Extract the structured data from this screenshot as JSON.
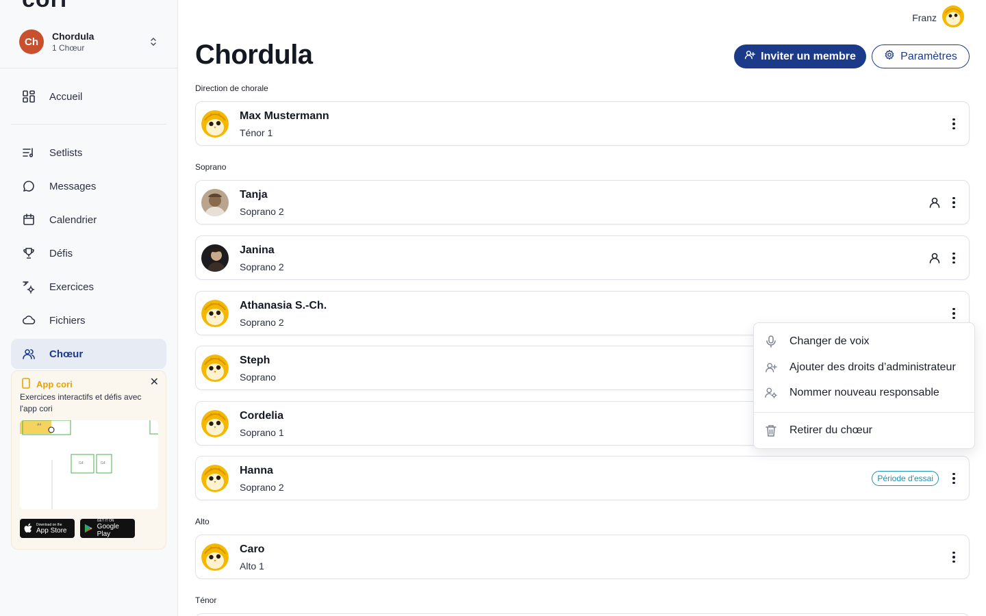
{
  "app": {
    "logo": "cori"
  },
  "user": {
    "name": "Franz"
  },
  "sidebar": {
    "choir": {
      "initials": "Ch",
      "name": "Chordula",
      "count": "1 Chœur"
    },
    "nav_top": [
      {
        "label": "Accueil",
        "icon": "grid-icon"
      }
    ],
    "nav": [
      {
        "label": "Setlists",
        "icon": "setlist-icon"
      },
      {
        "label": "Messages",
        "icon": "chat-bubble-icon"
      },
      {
        "label": "Calendrier",
        "icon": "calendar-icon"
      },
      {
        "label": "Défis",
        "icon": "trophy-icon"
      },
      {
        "label": "Exercices",
        "icon": "exercise-icon"
      },
      {
        "label": "Fichiers",
        "icon": "cloud-icon"
      },
      {
        "label": "Chœur",
        "icon": "users-icon",
        "active": true
      }
    ],
    "promo": {
      "title": "App cori",
      "text": "Exercices interactifs et défis avec l'app cori",
      "appstore_small": "Download on the",
      "appstore_big": "App Store",
      "googleplay_small": "GET IT ON",
      "googleplay_big": "Google Play",
      "image_notes": [
        "A4",
        "G4",
        "G4"
      ]
    }
  },
  "page": {
    "title": "Chordula",
    "invite_label": "Inviter un membre",
    "settings_label": "Paramètres"
  },
  "sections": [
    {
      "label": "Direction de chorale"
    },
    {
      "label": "Soprano"
    },
    {
      "label": "Alto"
    },
    {
      "label": "Ténor"
    }
  ],
  "members": [
    {
      "name": "Max Mustermann",
      "voice": "Ténor 1",
      "avatar": "mascot"
    },
    {
      "name": "Tanja",
      "voice": "Soprano 2",
      "avatar": "photo-light",
      "has_person_icon": true
    },
    {
      "name": "Janina",
      "voice": "Soprano 2",
      "avatar": "photo-dark",
      "has_person_icon": true
    },
    {
      "name": "Athanasia S.-Ch.",
      "voice": "Soprano 2",
      "avatar": "mascot"
    },
    {
      "name": "Steph",
      "voice": "Soprano",
      "avatar": "mascot"
    },
    {
      "name": "Cordelia",
      "voice": "Soprano 1",
      "avatar": "mascot"
    },
    {
      "name": "Hanna",
      "voice": "Soprano 2",
      "avatar": "mascot",
      "badge": "Période d'essai"
    },
    {
      "name": "Caro",
      "voice": "Alto 1",
      "avatar": "mascot"
    }
  ],
  "menu": {
    "items": [
      {
        "label": "Changer de voix",
        "icon": "microphone-icon"
      },
      {
        "label": "Ajouter des droits d’administrateur",
        "icon": "user-plus-icon"
      },
      {
        "label": "Nommer nouveau responsable",
        "icon": "user-cog-icon"
      },
      {
        "label": "Retirer du chœur",
        "icon": "trash-icon"
      }
    ]
  },
  "colors": {
    "primary": "#1b3a8a",
    "choir_avatar": "#c8502f",
    "promo_accent": "#e8a300",
    "badge": "#1a8fb8"
  }
}
